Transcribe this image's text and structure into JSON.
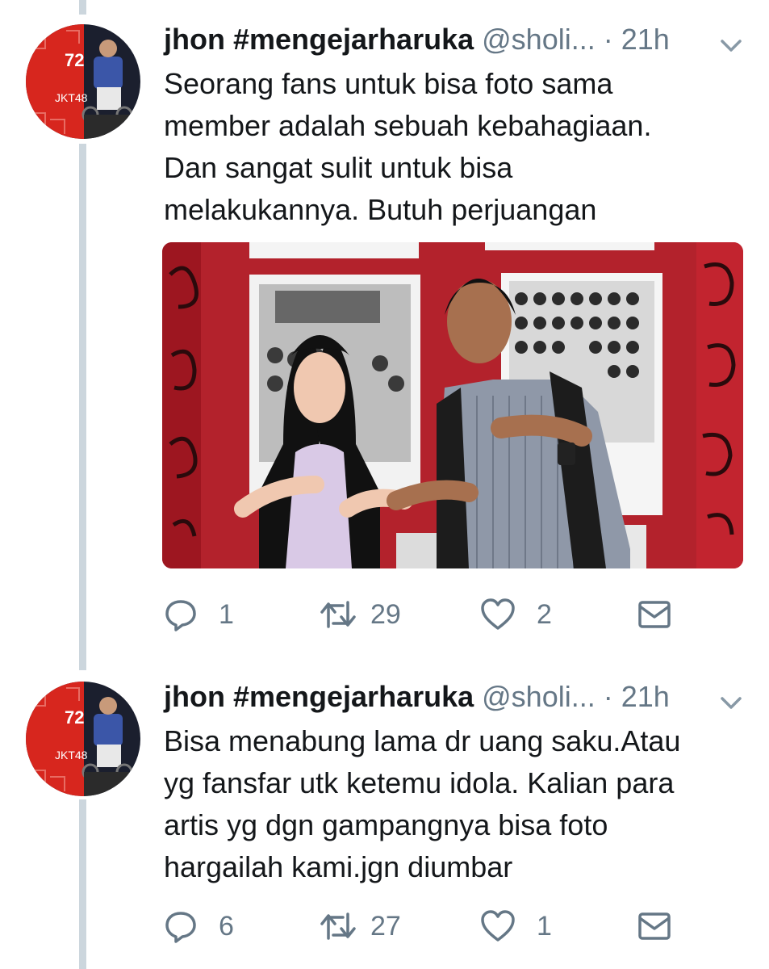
{
  "tweets": [
    {
      "author_name": "jhon #mengejarharuka",
      "author_handle": "@sholi...",
      "separator": "·",
      "time": "21h",
      "text_lines": [
        "Seorang fans untuk bisa foto sama",
        "member adalah sebuah kebahagiaan.",
        "Dan sangat sulit untuk bisa",
        "melakukannya. Butuh perjuangan"
      ],
      "has_photo": true,
      "reply_count": "1",
      "retweet_count": "29",
      "like_count": "2"
    },
    {
      "author_name": "jhon #mengejarharuka",
      "author_handle": "@sholi...",
      "separator": "·",
      "time": "21h",
      "text_lines": [
        "Bisa menabung lama dr uang saku.Atau",
        "yg fansfar utk ketemu idola. Kalian para",
        "artis yg dgn gampangnya bisa foto",
        "hargailah kami.jgn diumbar"
      ],
      "has_photo": false,
      "reply_count": "6",
      "retweet_count": "27",
      "like_count": "1"
    }
  ],
  "avatar_text": {
    "number": "72",
    "group": "JKT48"
  },
  "icons": {
    "reply": "reply-icon",
    "retweet": "retweet-icon",
    "like": "heart-icon",
    "message": "direct-message-icon",
    "menu": "chevron-down-icon"
  },
  "colors": {
    "primary_text": "#14171a",
    "secondary_text": "#657786",
    "thread_line": "#ccd6dd",
    "avatar_red": "#d7261e"
  }
}
